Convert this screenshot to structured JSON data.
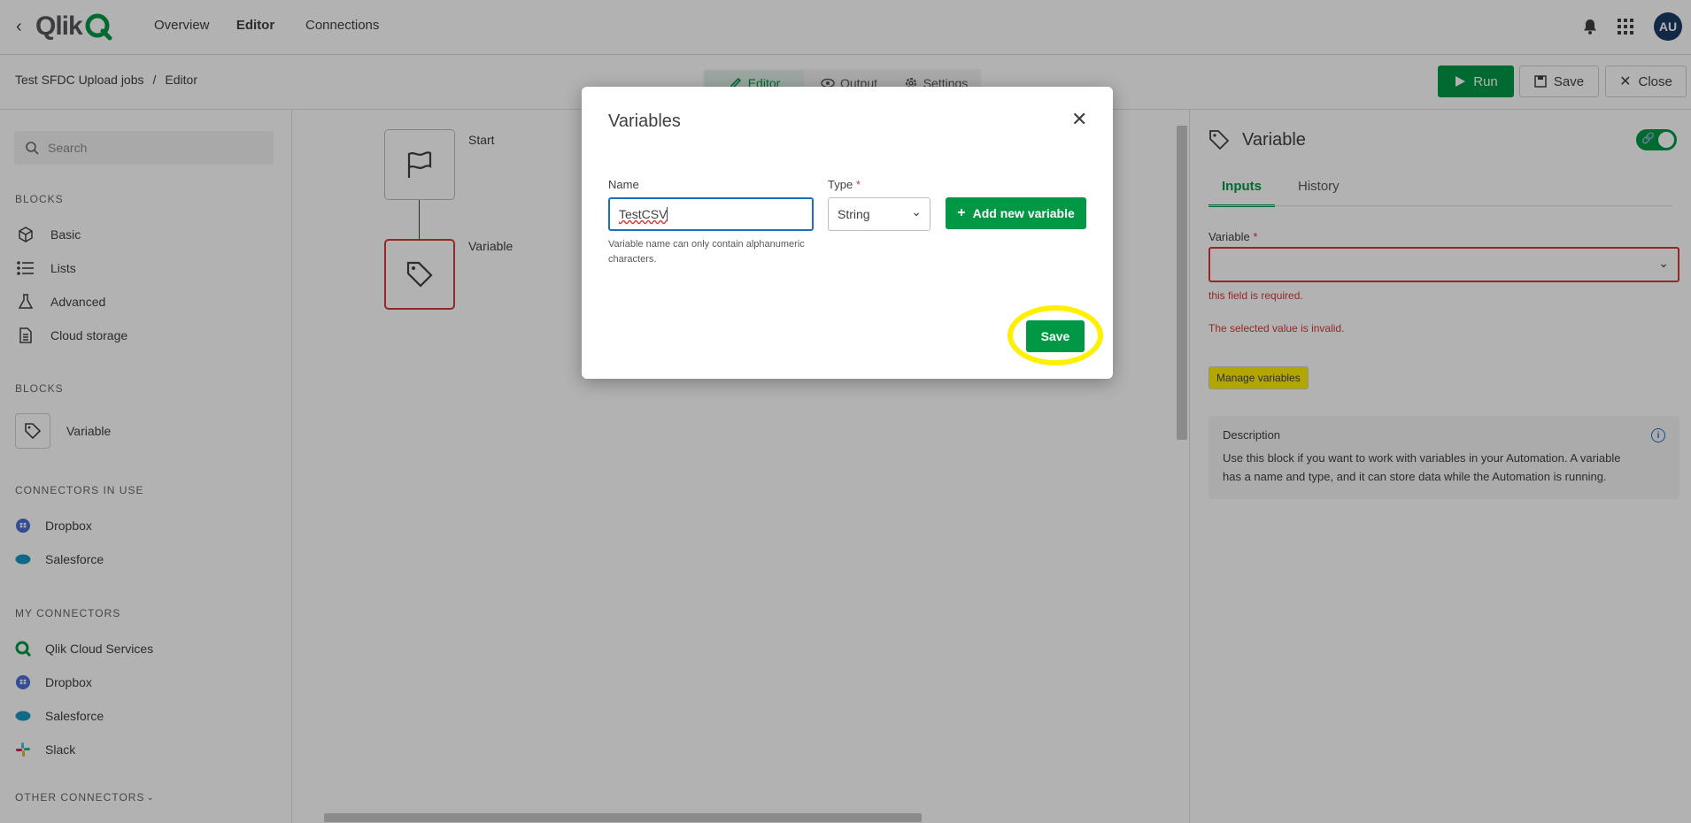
{
  "nav": {
    "logo_text": "Qlik",
    "tabs": [
      "Overview",
      "Editor",
      "Connections"
    ],
    "avatar": "AU"
  },
  "subbar": {
    "breadcrumb": [
      "Test SFDC Upload jobs",
      "/",
      "Editor"
    ],
    "view_tabs": [
      "Editor",
      "Output",
      "Settings"
    ],
    "run_label": "Run",
    "save_label": "Save",
    "close_label": "Close"
  },
  "left": {
    "search_placeholder": "Search",
    "sections": [
      {
        "title": "BLOCKS",
        "items": [
          {
            "label": "Basic",
            "icon": "cube-icon"
          },
          {
            "label": "Lists",
            "icon": "list-icon"
          },
          {
            "label": "Advanced",
            "icon": "flask-icon"
          },
          {
            "label": "Cloud storage",
            "icon": "file-icon"
          }
        ]
      },
      {
        "title": "BLOCKS",
        "items": [
          {
            "label": "Variable",
            "icon": "tag-icon"
          }
        ]
      },
      {
        "title": "CONNECTORS IN USE",
        "items": [
          {
            "label": "Dropbox",
            "icon": "dropbox-icon"
          },
          {
            "label": "Salesforce",
            "icon": "salesforce-icon"
          }
        ]
      },
      {
        "title": "MY CONNECTORS",
        "items": [
          {
            "label": "Qlik Cloud Services",
            "icon": "qlik-icon"
          },
          {
            "label": "Dropbox",
            "icon": "dropbox-icon"
          },
          {
            "label": "Salesforce",
            "icon": "salesforce-icon"
          },
          {
            "label": "Slack",
            "icon": "slack-icon"
          }
        ]
      },
      {
        "title": "OTHER CONNECTORS",
        "items": []
      }
    ]
  },
  "canvas": {
    "start_label": "Start",
    "variable_label": "Variable"
  },
  "right": {
    "title": "Variable",
    "tabs": [
      "Inputs",
      "History"
    ],
    "field_label": "Variable",
    "required_mark": "*",
    "error_required": "this field is required.",
    "error_invalid": "The selected value is invalid.",
    "manage_label": "Manage variables",
    "desc_title": "Description",
    "desc_text": "Use this block if you want to work with variables in your Automation. A variable has a name and type, and it can store data while the Automation is running."
  },
  "modal": {
    "title": "Variables",
    "name_label": "Name",
    "name_value": "TestCSV",
    "type_label": "Type",
    "required_mark": "*",
    "type_value": "String",
    "add_label": "Add new variable",
    "hint": "Variable name can only contain alphanumeric characters.",
    "save_label": "Save"
  },
  "colors": {
    "brand_green": "#009845",
    "error_red": "#d43a3a",
    "highlight_yellow": "#ffef00"
  }
}
